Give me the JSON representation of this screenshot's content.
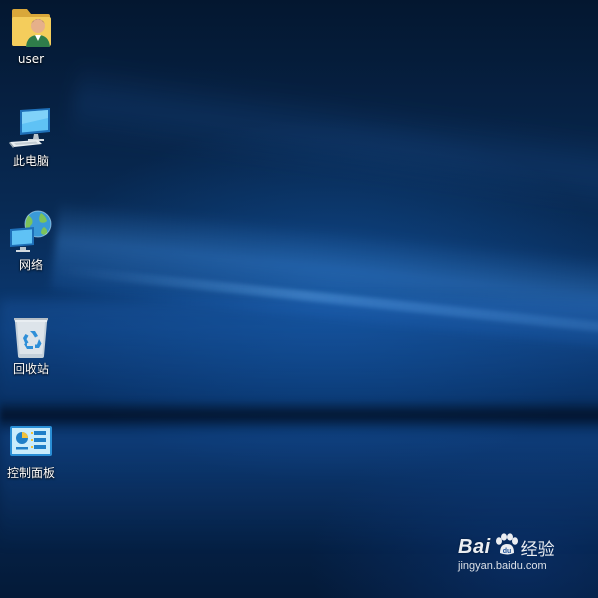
{
  "desktop": {
    "icons": [
      {
        "id": "user",
        "label": "user",
        "icon": "user-folder-icon"
      },
      {
        "id": "pc",
        "label": "此电脑",
        "icon": "computer-icon"
      },
      {
        "id": "network",
        "label": "网络",
        "icon": "network-icon"
      },
      {
        "id": "recycle",
        "label": "回收站",
        "icon": "recycle-bin-icon"
      },
      {
        "id": "control",
        "label": "控制面板",
        "icon": "control-panel-icon"
      }
    ]
  },
  "watermark": {
    "brand": "Bai",
    "brand_suffix": "",
    "product": "经验",
    "url": "jingyan.baidu.com"
  },
  "colors": {
    "wallpaper_dark": "#041730",
    "wallpaper_mid": "#0b3a74",
    "label_text": "#ffffff"
  }
}
